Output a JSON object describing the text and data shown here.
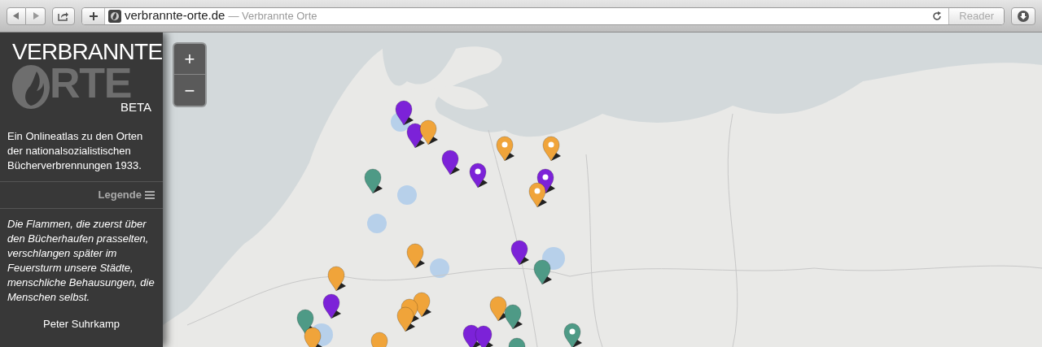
{
  "browser": {
    "url": "verbrannte-orte.de",
    "page_title": "— Verbrannte Orte",
    "reader_label": "Reader"
  },
  "sidebar": {
    "logo": {
      "top": "VERBRANNTE",
      "bottom": "RTE",
      "badge": "BETA"
    },
    "intro": "Ein Onlineatlas zu den Orten der nationalsozialistischen Bücherverbrennungen 1933.",
    "legend_label": "Legende",
    "quote": "Die Flammen, die zuerst über den Bücherhaufen prasselten, verschlangen später im Feuersturm unsere Städte, menschliche Behausungen, die Menschen selbst.",
    "quote_author": "Peter Suhrkamp"
  },
  "map": {
    "zoom_in": "+",
    "zoom_out": "−",
    "markers": [
      {
        "color": "#7c22d8",
        "dot": false
      },
      {
        "color": "#7c22d8",
        "dot": false
      },
      {
        "color": "#f0a43a",
        "dot": false
      },
      {
        "color": "#7c22d8",
        "dot": false
      },
      {
        "color": "#f0a43a",
        "dot": true
      },
      {
        "color": "#f0a43a",
        "dot": true
      },
      {
        "color": "#7c22d8",
        "dot": true
      },
      {
        "color": "#7c22d8",
        "dot": true
      },
      {
        "color": "#f0a43a",
        "dot": true
      },
      {
        "color": "#4e9a86",
        "dot": false
      },
      {
        "color": "#f0a43a",
        "dot": false
      },
      {
        "color": "#7c22d8",
        "dot": false
      },
      {
        "color": "#4e9a86",
        "dot": false
      },
      {
        "color": "#f0a43a",
        "dot": false
      },
      {
        "color": "#7c22d8",
        "dot": false
      },
      {
        "color": "#f0a43a",
        "dot": false
      },
      {
        "color": "#4e9a86",
        "dot": false
      },
      {
        "color": "#f0a43a",
        "dot": false
      },
      {
        "color": "#f0a43a",
        "dot": false
      },
      {
        "color": "#f0a43a",
        "dot": false
      },
      {
        "color": "#4e9a86",
        "dot": false
      },
      {
        "color": "#f0a43a",
        "dot": false
      },
      {
        "color": "#f0a43a",
        "dot": false
      },
      {
        "color": "#7c22d8",
        "dot": false
      },
      {
        "color": "#7c22d8",
        "dot": false
      },
      {
        "color": "#4e9a86",
        "dot": false
      },
      {
        "color": "#4e9a86",
        "dot": true
      }
    ]
  }
}
